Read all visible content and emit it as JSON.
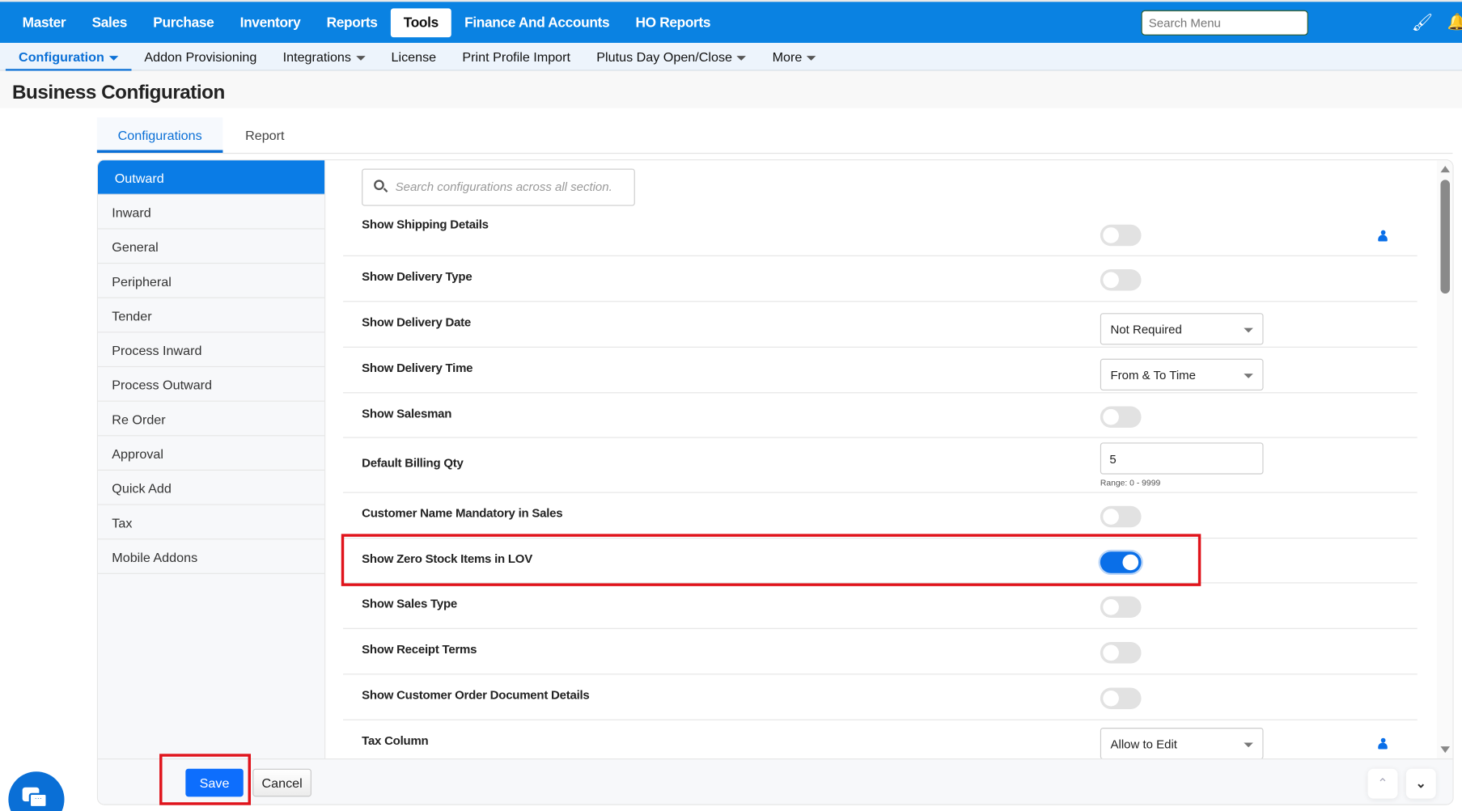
{
  "topnav": {
    "items": [
      "Master",
      "Sales",
      "Purchase",
      "Inventory",
      "Reports",
      "Tools",
      "Finance And Accounts",
      "HO Reports"
    ],
    "active": "Tools",
    "search_placeholder": "Search Menu"
  },
  "subnav": {
    "items": [
      "Configuration",
      "Addon Provisioning",
      "Integrations",
      "License",
      "Print Profile Import",
      "Plutus Day Open/Close",
      "More"
    ]
  },
  "page_title": "Business Configuration",
  "tabs": {
    "configurations": "Configurations",
    "report": "Report"
  },
  "sidebar": {
    "items": [
      "Outward",
      "Inward",
      "General",
      "Peripheral",
      "Tender",
      "Process Inward",
      "Process Outward",
      "Re Order",
      "Approval",
      "Quick Add",
      "Tax",
      "Mobile Addons"
    ]
  },
  "search": {
    "placeholder": "Search configurations across all section."
  },
  "rows": [
    {
      "label": "Show Shipping Details",
      "type": "toggle",
      "on": false,
      "user_icon": true
    },
    {
      "label": "Show Delivery Type",
      "type": "toggle",
      "on": false
    },
    {
      "label": "Show Delivery Date",
      "type": "select",
      "value": "Not Required"
    },
    {
      "label": "Show Delivery Time",
      "type": "select",
      "value": "From & To Time"
    },
    {
      "label": "Show Salesman",
      "type": "toggle",
      "on": false
    },
    {
      "label": "Default Billing Qty",
      "type": "input",
      "value": "5",
      "hint": "Range: 0 - 9999"
    },
    {
      "label": "Customer Name Mandatory in Sales",
      "type": "toggle",
      "on": false
    },
    {
      "label": "Show Zero Stock Items in LOV",
      "type": "toggle",
      "on": true
    },
    {
      "label": "Show Sales Type",
      "type": "toggle",
      "on": false
    },
    {
      "label": "Show Receipt Terms",
      "type": "toggle",
      "on": false
    },
    {
      "label": "Show Customer Order Document Details",
      "type": "toggle",
      "on": false
    },
    {
      "label": "Tax Column",
      "type": "select",
      "value": "Allow to Edit",
      "user_icon": true
    }
  ],
  "footer": {
    "save": "Save",
    "cancel": "Cancel"
  },
  "colors": {
    "brand": "#0a82e2",
    "accent": "#0d6efd",
    "highlight": "#e0141c"
  }
}
